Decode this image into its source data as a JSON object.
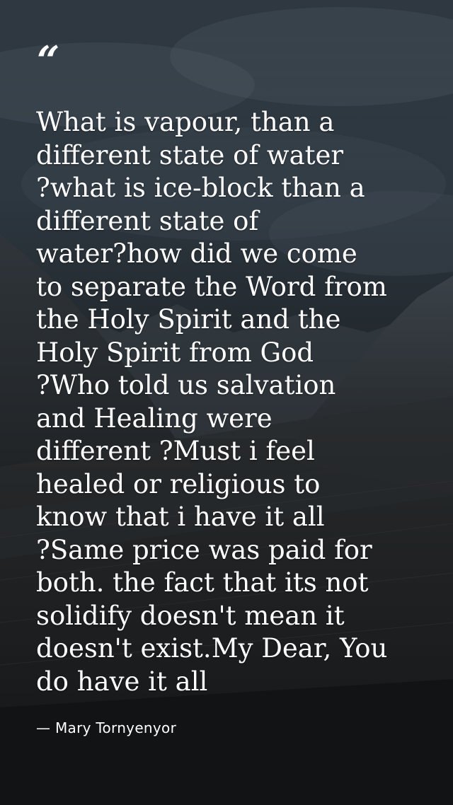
{
  "quote": {
    "mark": "“",
    "lines": [
      "What is vapour, than a",
      "different state of water",
      "?what is ice-block than a",
      "different state of",
      "water?how did we come",
      "to separate the Word from",
      "the Holy Spirit and the",
      "Holy Spirit from God",
      "?Who told us salvation",
      "and Healing were",
      "different ?Must i feel",
      "healed or religious to",
      "know that i have it all",
      "?Same price was paid for",
      "both. the fact that its not",
      "solidify doesn't mean it",
      "doesn't exist.My Dear, You",
      "do have it all"
    ],
    "author": "— Mary Tornyenyor"
  },
  "colors": {
    "text": "#ffffff",
    "sky_top": "#3f4a55",
    "ground": "#1a1c1d"
  }
}
